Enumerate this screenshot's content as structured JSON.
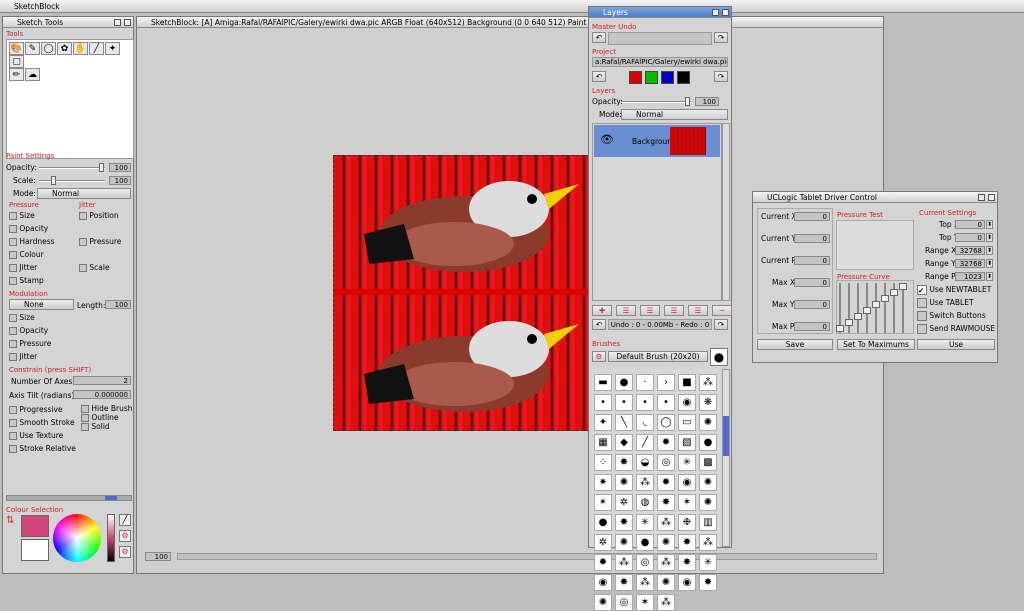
{
  "app_title": "SketchBlock",
  "sketch_tools": {
    "title": "Sketch Tools",
    "tools_label": "Tools",
    "tool_icons": [
      "palette-icon",
      "brush-icon",
      "circle-icon",
      "stamp-icon",
      "hand-icon",
      "eyedropper-icon",
      "magic-wand-icon",
      "select-rect-icon",
      "pencil-icon",
      "smudge-icon"
    ],
    "paint_settings": "Paint Settings",
    "opacity_label": "Opacity:",
    "opacity_value": "100",
    "scale_label": "Scale:",
    "scale_value": "100",
    "mode_label": "Mode:",
    "mode_value": "Normal",
    "pressure_label": "Pressure",
    "jitter_label": "Jitter",
    "pressure_items": [
      "Size",
      "Opacity",
      "Hardness",
      "Colour",
      "Jitter",
      "Stamp"
    ],
    "jitter_items": [
      "Position",
      "Pressure",
      "Scale"
    ],
    "modulation_label": "Modulation",
    "modulation_value": "None",
    "length_label": "Length:",
    "length_value": "100",
    "modulation_items": [
      "Size",
      "Opacity",
      "Pressure",
      "Jitter"
    ],
    "constrain_label": "Constrain (press SHIFT)",
    "axes_label": "Number Of Axes:",
    "axes_value": "2",
    "tilt_label": "Axis Tilt (radians):",
    "tilt_value": "0.000000",
    "options": [
      "Progressive",
      "Smooth Stroke",
      "Use Texture",
      "Stroke Relative"
    ],
    "hide_brush": "Hide Brush",
    "outline": "Outline",
    "solid": "Solid",
    "colour_selection": "Colour Selection",
    "fg_color": "#d0457a",
    "bg_color": "#ffffff"
  },
  "canvas": {
    "title": "SketchBlock:  [A]  Amiga:Rafal/RAFAlPIC/Galery/ewirki dwa.pic   ARGB Float (640x512) Background (0 0 640 512) Paint",
    "zoom": "100"
  },
  "layers": {
    "title": "Layers",
    "master_undo": "Master Undo",
    "project_label": "Project",
    "project_path": "a:Rafal/RAFAlPIC/Galery/ewirki dwa.pic",
    "swatches": [
      "#dd0000",
      "#00bb00",
      "#0000cc",
      "#000000"
    ],
    "layers_label": "Layers",
    "opacity_label": "Opacity:",
    "opacity_value": "100",
    "mode_label": "Mode:",
    "mode_value": "Normal",
    "layer_name": "Background",
    "undo_status": "Undo : 0 - 0.00Mb - Redo : 0",
    "brushes_label": "Brushes",
    "brush_name": "Default Brush (20x20)"
  },
  "tablet": {
    "title": "UCLogic Tablet Driver Control",
    "current_x": "Current X",
    "current_x_val": "0",
    "current_y": "Current Y",
    "current_y_val": "0",
    "current_p": "Current P",
    "current_p_val": "0",
    "max_x": "Max X",
    "max_x_val": "0",
    "max_y": "Max Y",
    "max_y_val": "0",
    "max_p": "Max P",
    "max_p_val": "0",
    "pressure_test": "Pressure Test",
    "pressure_curve": "Pressure Curve",
    "current_settings": "Current Settings",
    "top_x": "Top X",
    "top_x_val": "0",
    "top_y": "Top Y",
    "top_y_val": "0",
    "range_x": "Range X",
    "range_x_val": "32768",
    "range_y": "Range Y",
    "range_y_val": "32768",
    "range_p": "Range P",
    "range_p_val": "1023",
    "use_newtablet": "Use NEWTABLET",
    "use_tablet": "Use TABLET",
    "switch_buttons": "Switch Buttons",
    "send_rawmouse": "Send RAWMOUSE",
    "save": "Save",
    "set_max": "Set To Maximums",
    "use": "Use"
  }
}
